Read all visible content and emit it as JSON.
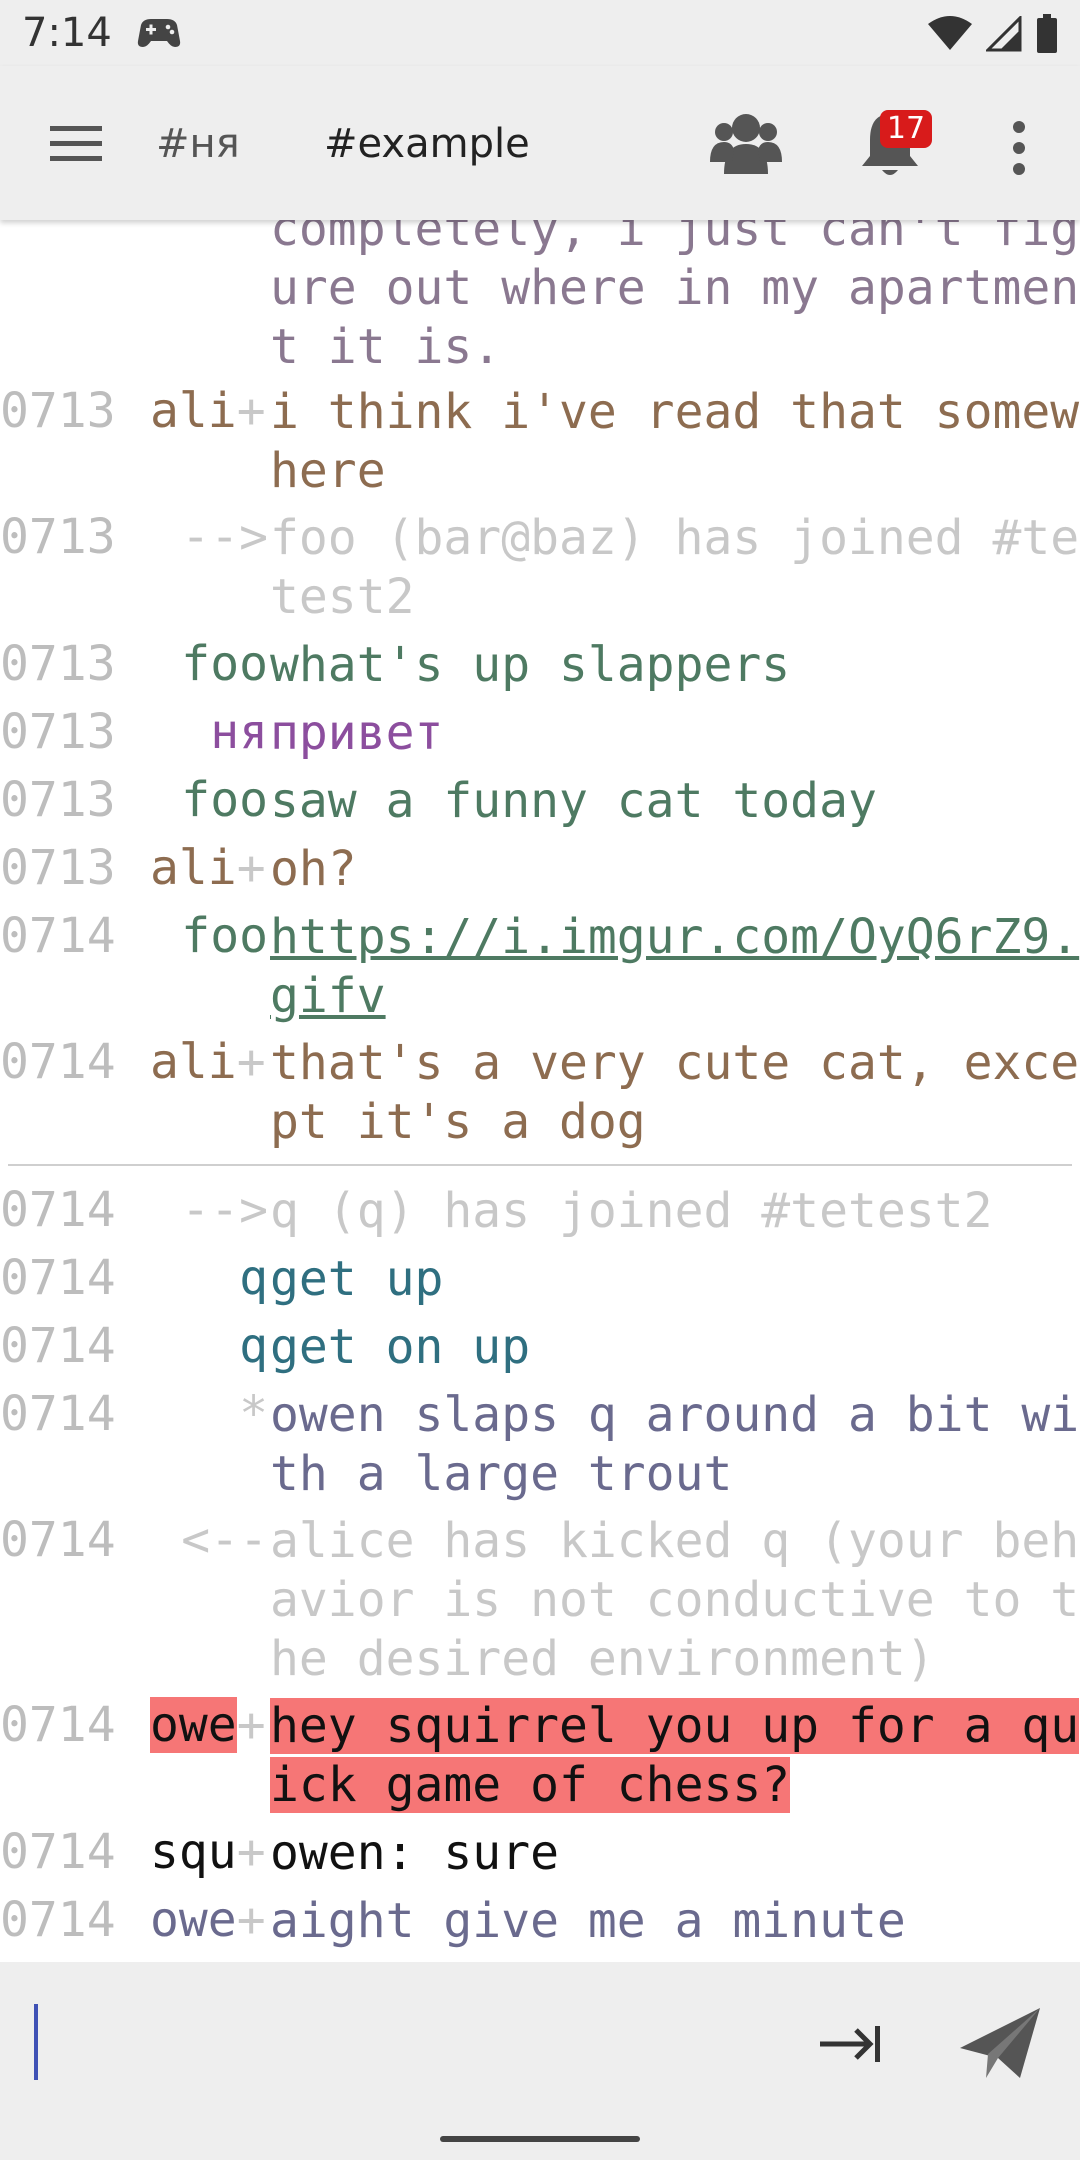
{
  "status_bar": {
    "time": "7:14",
    "icons": [
      "gamepad-icon",
      "wifi-icon",
      "signal-icon",
      "battery-icon"
    ]
  },
  "toolbar": {
    "tabs": [
      {
        "label": "#ня",
        "active": false
      },
      {
        "label": "#example",
        "active": true
      }
    ],
    "notification_count": "17",
    "icons": [
      "menu-icon",
      "users-icon",
      "bell-icon",
      "more-vert-icon"
    ]
  },
  "messages": [
    {
      "time": "",
      "nick": "",
      "text": "completely, i just can't figure out where in my apartment it is.",
      "color": "#8a7890"
    },
    {
      "time": "0713",
      "nick": "ali",
      "trunc": "+",
      "text": "i think i've read that somewhere",
      "color": "#8d6c50"
    },
    {
      "time": "0713",
      "nick": "-->",
      "text": "foo (bar@baz) has joined #tetest2",
      "color": "#c8c8c8"
    },
    {
      "time": "0713",
      "nick": "foo",
      "text": "what's up slappers",
      "color": "#4e7a62"
    },
    {
      "time": "0713",
      "nick": "ня",
      "text": "привет",
      "color": "#8c4e9e"
    },
    {
      "time": "0713",
      "nick": "foo",
      "text": "saw a funny cat today",
      "color": "#4e7a62"
    },
    {
      "time": "0713",
      "nick": "ali",
      "trunc": "+",
      "text": "oh?",
      "color": "#8d6c50"
    },
    {
      "time": "0714",
      "nick": "foo",
      "text": "https://i.imgur.com/OyQ6rZ9.gifv",
      "color": "#4e7a62",
      "link": true
    },
    {
      "time": "0714",
      "nick": "ali",
      "trunc": "+",
      "text": "that's a very cute cat, except it's a dog",
      "color": "#8d6c50"
    },
    {
      "time": "0714",
      "nick": "-->",
      "text": "q (q) has joined #tetest2",
      "color": "#c8c8c8"
    },
    {
      "time": "0714",
      "nick": "q",
      "text": "get up",
      "color": "#2f6f80"
    },
    {
      "time": "0714",
      "nick": "q",
      "text": "get on up",
      "color": "#2f6f80"
    },
    {
      "time": "0714",
      "nick": "*",
      "text": "owen slaps q around a bit with a large trout",
      "color": "#6a6a8e",
      "nick_color": "#c8c8c8"
    },
    {
      "time": "0714",
      "nick": "<--",
      "text": "alice has kicked q (your behavior is not conductive to the desired environment)",
      "color": "#c8c8c8"
    },
    {
      "time": "0714",
      "nick": "owe",
      "trunc": "+",
      "text": "hey squirrel you up for a quick game of chess?",
      "color": "#111111",
      "highlight": true
    },
    {
      "time": "0714",
      "nick": "squ",
      "trunc": "+",
      "text": "owen: sure",
      "color": "#111111"
    },
    {
      "time": "0714",
      "nick": "owe",
      "trunc": "+",
      "text": "aight give me a minute",
      "color": "#6a6a8e"
    }
  ],
  "input": {
    "value": "",
    "placeholder": ""
  },
  "colors": {
    "bar_bg": "#eeeeee",
    "highlight": "#f67676",
    "badge": "#d81b1b",
    "timestamp": "#bdbdbd"
  }
}
